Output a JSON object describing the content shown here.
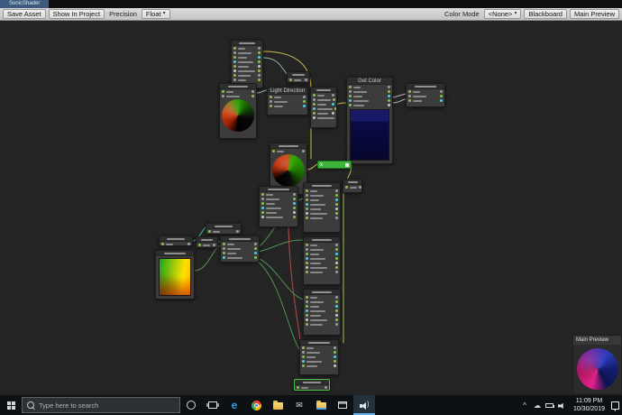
{
  "window": {
    "title": "SonicShader"
  },
  "toolbar": {
    "save_asset": "Save Asset",
    "show_in_project": "Show In Project",
    "precision_label": "Precision",
    "precision_value": "Float",
    "color_mode_label": "Color Mode",
    "color_mode_value": "<None>",
    "blackboard": "Blackboard",
    "main_preview": "Main Preview"
  },
  "graph": {
    "get_color_title": "Get Color",
    "light_direction_title": "Light Direction",
    "x_node_label": "x"
  },
  "preview_panel": {
    "title": "Main Preview"
  },
  "taskbar": {
    "search_placeholder": "Type here to search",
    "clock_time": "11:09 PM",
    "clock_date": "10/30/2019"
  },
  "icons": {
    "dropdown_arrow": "▾",
    "mail_glyph": "✉",
    "cloud_glyph": "☁",
    "chevron_up": "^",
    "edge_letter": "e"
  },
  "colors": {
    "wire_yellow": "#d8c94f",
    "wire_green": "#55a055",
    "wire_red": "#bf5252",
    "wire_cyan": "#52c3c3",
    "wire_lime": "#b8cc55",
    "wire_white": "#c9c9c9",
    "selection_green": "#4ec04e",
    "title_tab_blue": "#3c5a7e",
    "port_green": "#8bc34a"
  }
}
